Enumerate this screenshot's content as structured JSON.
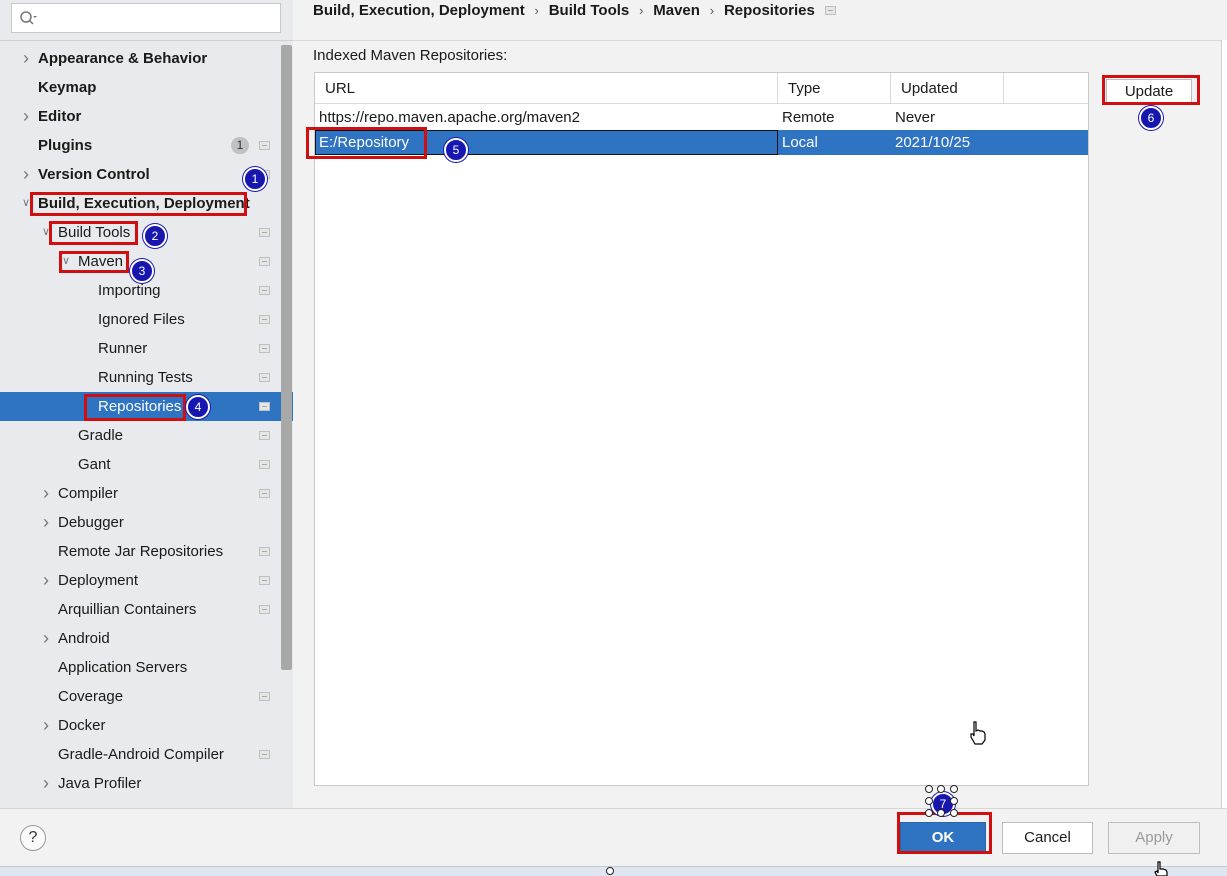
{
  "search": {
    "placeholder": ""
  },
  "sidebar": {
    "items": [
      {
        "label": "Appearance & Behavior",
        "bold": true,
        "arrow": "right",
        "level": 0,
        "proj": false
      },
      {
        "label": "Keymap",
        "bold": true,
        "arrow": "",
        "level": 0,
        "proj": false
      },
      {
        "label": "Editor",
        "bold": true,
        "arrow": "right",
        "level": 0,
        "proj": false
      },
      {
        "label": "Plugins",
        "bold": true,
        "arrow": "",
        "level": 0,
        "proj": true,
        "count": "1"
      },
      {
        "label": "Version Control",
        "bold": true,
        "arrow": "right",
        "level": 0,
        "proj": true
      },
      {
        "label": "Build, Execution, Deployment",
        "bold": true,
        "arrow": "down",
        "level": 0,
        "proj": false
      },
      {
        "label": "Build Tools",
        "bold": false,
        "arrow": "down",
        "level": 1,
        "proj": true
      },
      {
        "label": "Maven",
        "bold": false,
        "arrow": "down",
        "level": 2,
        "proj": true
      },
      {
        "label": "Importing",
        "bold": false,
        "arrow": "",
        "level": 3,
        "proj": true
      },
      {
        "label": "Ignored Files",
        "bold": false,
        "arrow": "",
        "level": 3,
        "proj": true
      },
      {
        "label": "Runner",
        "bold": false,
        "arrow": "",
        "level": 3,
        "proj": true
      },
      {
        "label": "Running Tests",
        "bold": false,
        "arrow": "",
        "level": 3,
        "proj": true
      },
      {
        "label": "Repositories",
        "bold": false,
        "arrow": "",
        "level": 3,
        "proj": true,
        "selected": true
      },
      {
        "label": "Gradle",
        "bold": false,
        "arrow": "",
        "level": 2,
        "proj": true
      },
      {
        "label": "Gant",
        "bold": false,
        "arrow": "",
        "level": 2,
        "proj": true
      },
      {
        "label": "Compiler",
        "bold": false,
        "arrow": "right",
        "level": 1,
        "proj": true
      },
      {
        "label": "Debugger",
        "bold": false,
        "arrow": "right",
        "level": 1,
        "proj": false
      },
      {
        "label": "Remote Jar Repositories",
        "bold": false,
        "arrow": "",
        "level": 1,
        "proj": true
      },
      {
        "label": "Deployment",
        "bold": false,
        "arrow": "right",
        "level": 1,
        "proj": true
      },
      {
        "label": "Arquillian Containers",
        "bold": false,
        "arrow": "",
        "level": 1,
        "proj": true
      },
      {
        "label": "Android",
        "bold": false,
        "arrow": "right",
        "level": 1,
        "proj": false
      },
      {
        "label": "Application Servers",
        "bold": false,
        "arrow": "",
        "level": 1,
        "proj": false
      },
      {
        "label": "Coverage",
        "bold": false,
        "arrow": "",
        "level": 1,
        "proj": true
      },
      {
        "label": "Docker",
        "bold": false,
        "arrow": "right",
        "level": 1,
        "proj": false
      },
      {
        "label": "Gradle-Android Compiler",
        "bold": false,
        "arrow": "",
        "level": 1,
        "proj": true
      },
      {
        "label": "Java Profiler",
        "bold": false,
        "arrow": "right",
        "level": 1,
        "proj": false
      }
    ]
  },
  "breadcrumb": [
    "Build, Execution, Deployment",
    "Build Tools",
    "Maven",
    "Repositories"
  ],
  "section_title": "Indexed Maven Repositories:",
  "table": {
    "headers": [
      "URL",
      "Type",
      "Updated"
    ],
    "rows": [
      {
        "url": "https://repo.maven.apache.org/maven2",
        "type": "Remote",
        "updated": "Never"
      },
      {
        "url": "E:/Repository",
        "type": "Local",
        "updated": "2021/10/25"
      }
    ]
  },
  "buttons": {
    "update": "Update",
    "ok": "OK",
    "cancel": "Cancel",
    "apply": "Apply",
    "help": "?"
  },
  "badges": [
    "1",
    "2",
    "3",
    "4",
    "5",
    "6",
    "7"
  ],
  "colors": {
    "selection": "#2f73c3",
    "highlight": "#d01010",
    "badge": "#1717b0"
  }
}
